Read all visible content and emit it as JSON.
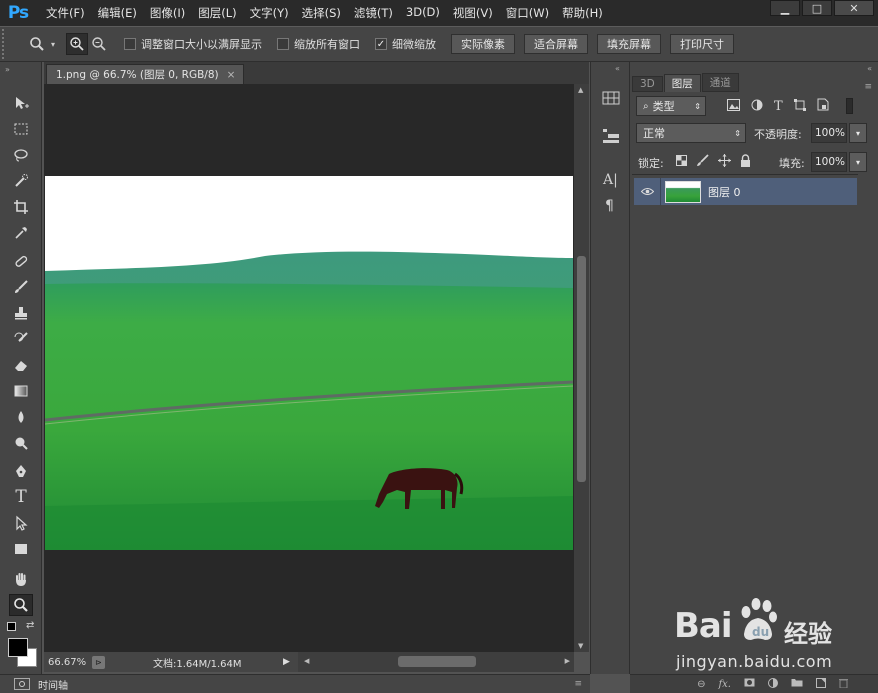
{
  "app": {
    "logo": "Ps"
  },
  "menu": [
    "文件(F)",
    "编辑(E)",
    "图像(I)",
    "图层(L)",
    "文字(Y)",
    "选择(S)",
    "滤镜(T)",
    "3D(D)",
    "视图(V)",
    "窗口(W)",
    "帮助(H)"
  ],
  "window_buttons": {
    "minimize": "▁",
    "maximize": "□",
    "close": "✕"
  },
  "options": {
    "checks": [
      {
        "label": "调整窗口大小以满屏显示",
        "checked": false
      },
      {
        "label": "缩放所有窗口",
        "checked": false
      },
      {
        "label": "细微缩放",
        "checked": true
      }
    ],
    "check_mark": "✓",
    "buttons": [
      "实际像素",
      "适合屏幕",
      "填充屏幕",
      "打印尺寸"
    ]
  },
  "document": {
    "tab_title": "1.png @ 66.7% (图层 0, RGB/8)",
    "tab_close": "×",
    "zoom": "66.67%",
    "doc_info": "文档:1.64M/1.64M"
  },
  "timeline": {
    "label": "时间轴"
  },
  "layers_panel": {
    "tabs": [
      "3D",
      "图层",
      "通道"
    ],
    "active_tab": "图层",
    "filter_kind": "类型",
    "blend_mode": "正常",
    "opacity_label": "不透明度:",
    "opacity_value": "100%",
    "lock_label": "锁定:",
    "fill_label": "填充:",
    "fill_value": "100%",
    "layers": [
      {
        "name": "图层 0",
        "visible": true
      }
    ],
    "bottom_icons": [
      "link-icon",
      "fx-icon",
      "mask-icon",
      "adjustment-icon",
      "folder-icon",
      "new-layer-icon",
      "trash-icon"
    ]
  },
  "watermark": {
    "brand": "Bai",
    "brand2": "经验",
    "url": "jingyan.baidu.com"
  },
  "colors": {
    "menubar": "#2a2a2a",
    "panel": "#454545",
    "canvas": "#282828",
    "selected_layer": "#4f5f7a",
    "ps_blue": "#31a8ff"
  },
  "icons": {
    "tools": [
      "move-tool-icon",
      "marquee-tool-icon",
      "lasso-tool-icon",
      "quick-select-tool-icon",
      "crop-tool-icon",
      "eyedropper-tool-icon",
      "healing-brush-tool-icon",
      "brush-tool-icon",
      "clone-stamp-tool-icon",
      "history-brush-tool-icon",
      "eraser-tool-icon",
      "gradient-tool-icon",
      "blur-tool-icon",
      "dodge-tool-icon",
      "pen-tool-icon",
      "type-tool-icon",
      "path-select-tool-icon",
      "rectangle-tool-icon",
      "hand-tool-icon",
      "zoom-tool-icon"
    ]
  }
}
